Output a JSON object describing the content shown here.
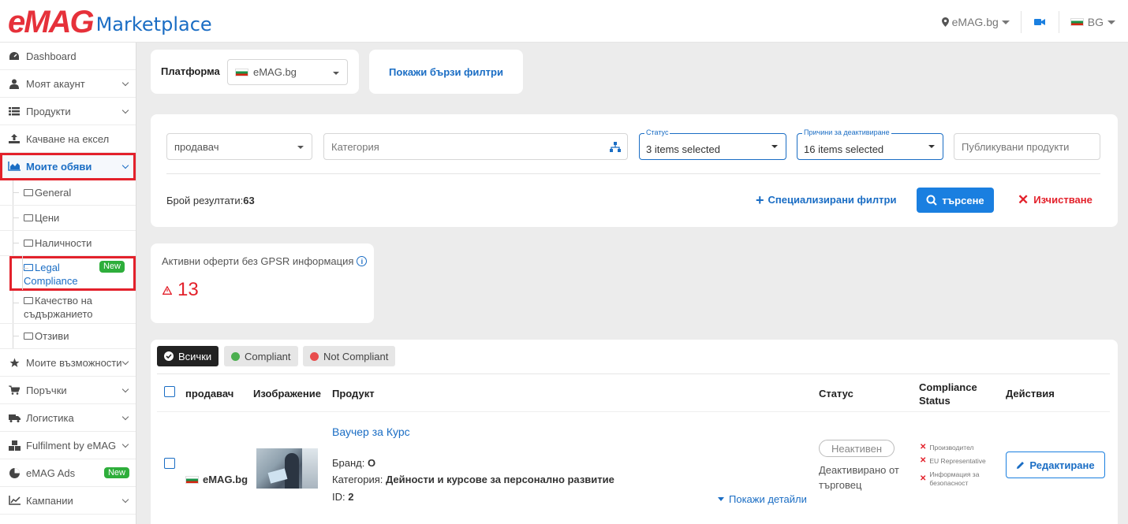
{
  "header": {
    "logo_brand": "eMAG",
    "logo_product": "Marketplace",
    "platform": "eMAG.bg",
    "language": "BG"
  },
  "sidebar": {
    "items": [
      {
        "label": "Dashboard",
        "icon": "dashboard-icon"
      },
      {
        "label": "Моят акаунт",
        "icon": "user-icon"
      },
      {
        "label": "Продукти",
        "icon": "list-icon"
      },
      {
        "label": "Качване на ексел",
        "icon": "upload-icon"
      },
      {
        "label": "Моите обяви",
        "icon": "area-chart-icon"
      }
    ],
    "sub_items": [
      "General",
      "Цени",
      "Наличности",
      "Legal Compliance",
      "Качество на съдържанието",
      "Отзиви"
    ],
    "new_badge": "New",
    "items_after": [
      {
        "label": "Моите възможности",
        "icon": "star-icon"
      },
      {
        "label": "Поръчки",
        "icon": "cart-icon"
      },
      {
        "label": "Логистика",
        "icon": "truck-icon"
      },
      {
        "label": "Fulfilment by eMAG",
        "icon": "cubes-icon"
      },
      {
        "label": "eMAG Ads",
        "icon": "ads-icon"
      },
      {
        "label": "Кампании",
        "icon": "line-chart-icon"
      }
    ]
  },
  "platform_card": {
    "label": "Платформа",
    "value": "eMAG.bg",
    "quick_filters": "Покажи бързи филтри"
  },
  "filters": {
    "seller_placeholder": "продавач",
    "category_placeholder": "Категория",
    "status_legend": "Статус",
    "status_value": "3 items selected",
    "reasons_legend": "Причини за деактивиране",
    "reasons_value": "16 items selected",
    "published_placeholder": "Публикувани продукти",
    "results_label": "Брой резултати:",
    "results_count": "63",
    "specialized": "Специализирани филтри",
    "search": "търсене",
    "clear": "Изчистване"
  },
  "gpsr": {
    "title": "Активни оферти без GPSR информация",
    "count": "13"
  },
  "tabs": {
    "all": "Всички",
    "compliant": "Compliant",
    "not_compliant": "Not Compliant"
  },
  "table": {
    "headers": {
      "seller": "продавач",
      "image": "Изображение",
      "product": "Продукт",
      "status": "Статус",
      "compliance_1": "Compliance",
      "compliance_2": "Status",
      "actions": "Действия"
    },
    "rows": [
      {
        "seller": "eMAG.bg",
        "product_title": "Ваучер за Курс",
        "brand_label": "Бранд:",
        "brand_value": "O",
        "category_label": "Категория:",
        "category_value": "Дейности и курсове за персонално развитие",
        "id_label": "ID:",
        "id_value": "2",
        "show_details": "Покажи детайли",
        "status_pill": "Неактивен",
        "status_note_1": "Деактивирано от",
        "status_note_2": "търговец",
        "compliance": [
          "Производител",
          "EU Representative",
          "Информация за",
          "безопасност"
        ],
        "edit": "Редактиране"
      }
    ]
  },
  "colors": {
    "brand_red": "#e6313a",
    "brand_blue": "#1a6dc4",
    "compliant": "#4caf50",
    "not_compliant": "#e84c4c"
  }
}
